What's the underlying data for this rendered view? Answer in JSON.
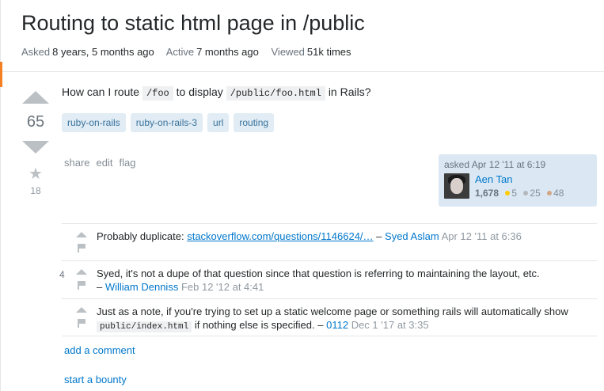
{
  "question": {
    "title": "Routing to static html page in /public",
    "meta": {
      "asked_label": "Asked",
      "asked_value": "8 years, 5 months ago",
      "active_label": "Active",
      "active_value": "7 months ago",
      "viewed_label": "Viewed",
      "viewed_value": "51k times"
    },
    "votes": "65",
    "favorites": "18",
    "body": {
      "part1": "How can I route",
      "code1": "/foo",
      "part2": "to display",
      "code2": "/public/foo.html",
      "part3": "in Rails?"
    },
    "tags": [
      "ruby-on-rails",
      "ruby-on-rails-3",
      "url",
      "routing"
    ],
    "menu": {
      "share": "share",
      "edit": "edit",
      "flag": "flag"
    },
    "owner": {
      "asked_text": "asked Apr 12 '11 at 6:19",
      "name": "Aen Tan",
      "reputation": "1,678",
      "gold": "5",
      "silver": "25",
      "bronze": "48",
      "gold_color": "#ffcc01",
      "silver_color": "#b4b8bc",
      "bronze_color": "#d1a684"
    }
  },
  "comments": [
    {
      "score": "",
      "text": "Probably duplicate:",
      "link": "stackoverflow.com/questions/1146624/…",
      "sep": "–",
      "user": "Syed Aslam",
      "date": "Apr 12 '11 at 6:36"
    },
    {
      "score": "4",
      "text": "Syed, it's not a dupe of that question since that question is referring to maintaining the layout, etc.",
      "sep": "–",
      "user": "William Denniss",
      "date": "Feb 12 '12 at 4:41"
    },
    {
      "score": "",
      "text": "Just as a note, if you're trying to set up a static welcome page or something rails will automatically show",
      "code": "public/index.html",
      "text2": "if nothing else is specified.",
      "sep": "–",
      "user": "0112",
      "date": "Dec 1 '17 at 3:35"
    }
  ],
  "add_comment": "add a comment",
  "start_bounty": "start a bounty"
}
